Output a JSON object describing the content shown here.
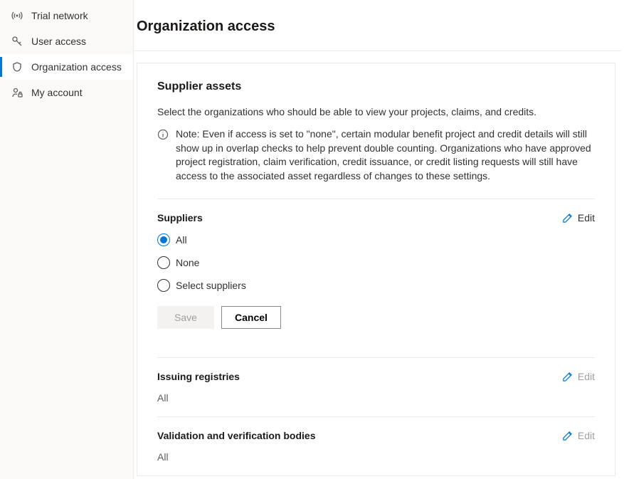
{
  "sidebar": {
    "items": [
      {
        "label": "Trial network",
        "icon": "broadcast-icon",
        "active": false
      },
      {
        "label": "User access",
        "icon": "key-icon",
        "active": false
      },
      {
        "label": "Organization access",
        "icon": "shield-icon",
        "active": true
      },
      {
        "label": "My account",
        "icon": "person-lock-icon",
        "active": false
      }
    ]
  },
  "page": {
    "title": "Organization access"
  },
  "card": {
    "title": "Supplier assets",
    "description": "Select the organizations who should be able to view your projects, claims, and credits.",
    "note": "Note: Even if access is set to \"none\", certain modular benefit project and credit details will still show up in overlap checks to help prevent double counting. Organizations who have approved project registration, claim verification, credit issuance, or credit listing requests will still have access to the associated asset regardless of changes to these settings."
  },
  "suppliers": {
    "title": "Suppliers",
    "edit_label": "Edit",
    "options": [
      "All",
      "None",
      "Select suppliers"
    ],
    "selected": "All",
    "save_label": "Save",
    "cancel_label": "Cancel"
  },
  "issuing": {
    "title": "Issuing registries",
    "edit_label": "Edit",
    "value": "All"
  },
  "vvb": {
    "title": "Validation and verification bodies",
    "edit_label": "Edit",
    "value": "All"
  }
}
